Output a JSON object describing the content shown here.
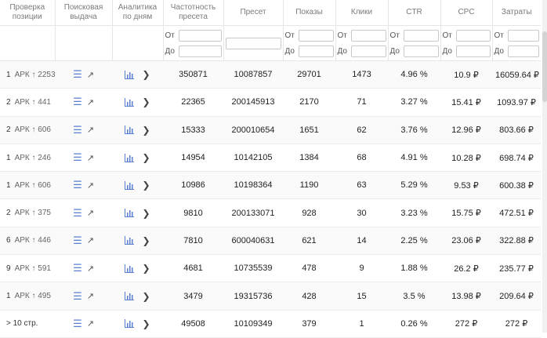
{
  "headers": [
    "Проверка\nпозиции",
    "Поисковая\nвыдача",
    "Аналитика\nпо дням",
    "Частотность\nпресета",
    "Пресет",
    "Показы",
    "Клики",
    "CTR",
    "CPC",
    "Затраты"
  ],
  "filters": {
    "from_label": "От",
    "to_label": "До"
  },
  "rows": [
    {
      "rank": "1",
      "apk": "АРК ↑ 2253",
      "freq": "350871",
      "preset": "10087857",
      "shows": "29701",
      "clicks": "1473",
      "ctr": "4.96 %",
      "cpc": "10.9 ₽",
      "cost": "16059.64 ₽"
    },
    {
      "rank": "2",
      "apk": "АРК ↑ 441",
      "freq": "22365",
      "preset": "200145913",
      "shows": "2170",
      "clicks": "71",
      "ctr": "3.27 %",
      "cpc": "15.41 ₽",
      "cost": "1093.97 ₽"
    },
    {
      "rank": "2",
      "apk": "АРК ↑ 606",
      "freq": "15333",
      "preset": "200010654",
      "shows": "1651",
      "clicks": "62",
      "ctr": "3.76 %",
      "cpc": "12.96 ₽",
      "cost": "803.66 ₽"
    },
    {
      "rank": "1",
      "apk": "АРК ↑ 246",
      "freq": "14954",
      "preset": "10142105",
      "shows": "1384",
      "clicks": "68",
      "ctr": "4.91 %",
      "cpc": "10.28 ₽",
      "cost": "698.74 ₽"
    },
    {
      "rank": "1",
      "apk": "АРК ↑ 606",
      "freq": "10986",
      "preset": "10198364",
      "shows": "1190",
      "clicks": "63",
      "ctr": "5.29 %",
      "cpc": "9.53 ₽",
      "cost": "600.38 ₽"
    },
    {
      "rank": "2",
      "apk": "АРК ↑ 375",
      "freq": "9810",
      "preset": "200133071",
      "shows": "928",
      "clicks": "30",
      "ctr": "3.23 %",
      "cpc": "15.75 ₽",
      "cost": "472.51 ₽"
    },
    {
      "rank": "6",
      "apk": "АРК ↑ 446",
      "freq": "7810",
      "preset": "600040631",
      "shows": "621",
      "clicks": "14",
      "ctr": "2.25 %",
      "cpc": "23.06 ₽",
      "cost": "322.88 ₽"
    },
    {
      "rank": "9",
      "apk": "АРК ↑ 591",
      "freq": "4681",
      "preset": "10735539",
      "shows": "478",
      "clicks": "9",
      "ctr": "1.88 %",
      "cpc": "26.2 ₽",
      "cost": "235.77 ₽"
    },
    {
      "rank": "1",
      "apk": "АРК ↑ 495",
      "freq": "3479",
      "preset": "19315736",
      "shows": "428",
      "clicks": "15",
      "ctr": "3.5 %",
      "cpc": "13.98 ₽",
      "cost": "209.64 ₽"
    },
    {
      "rank": "> 10 стр.",
      "apk": "",
      "freq": "49508",
      "preset": "10109349",
      "shows": "379",
      "clicks": "1",
      "ctr": "0.26 %",
      "cpc": "272 ₽",
      "cost": "272 ₽"
    }
  ],
  "icons": {
    "list": "list-icon",
    "external": "external-link-icon",
    "chart": "bar-chart-icon",
    "chevron": "chevron-right-icon"
  },
  "colors": {
    "accent": "#5a7fd1",
    "header_text": "#7b7b7b"
  }
}
